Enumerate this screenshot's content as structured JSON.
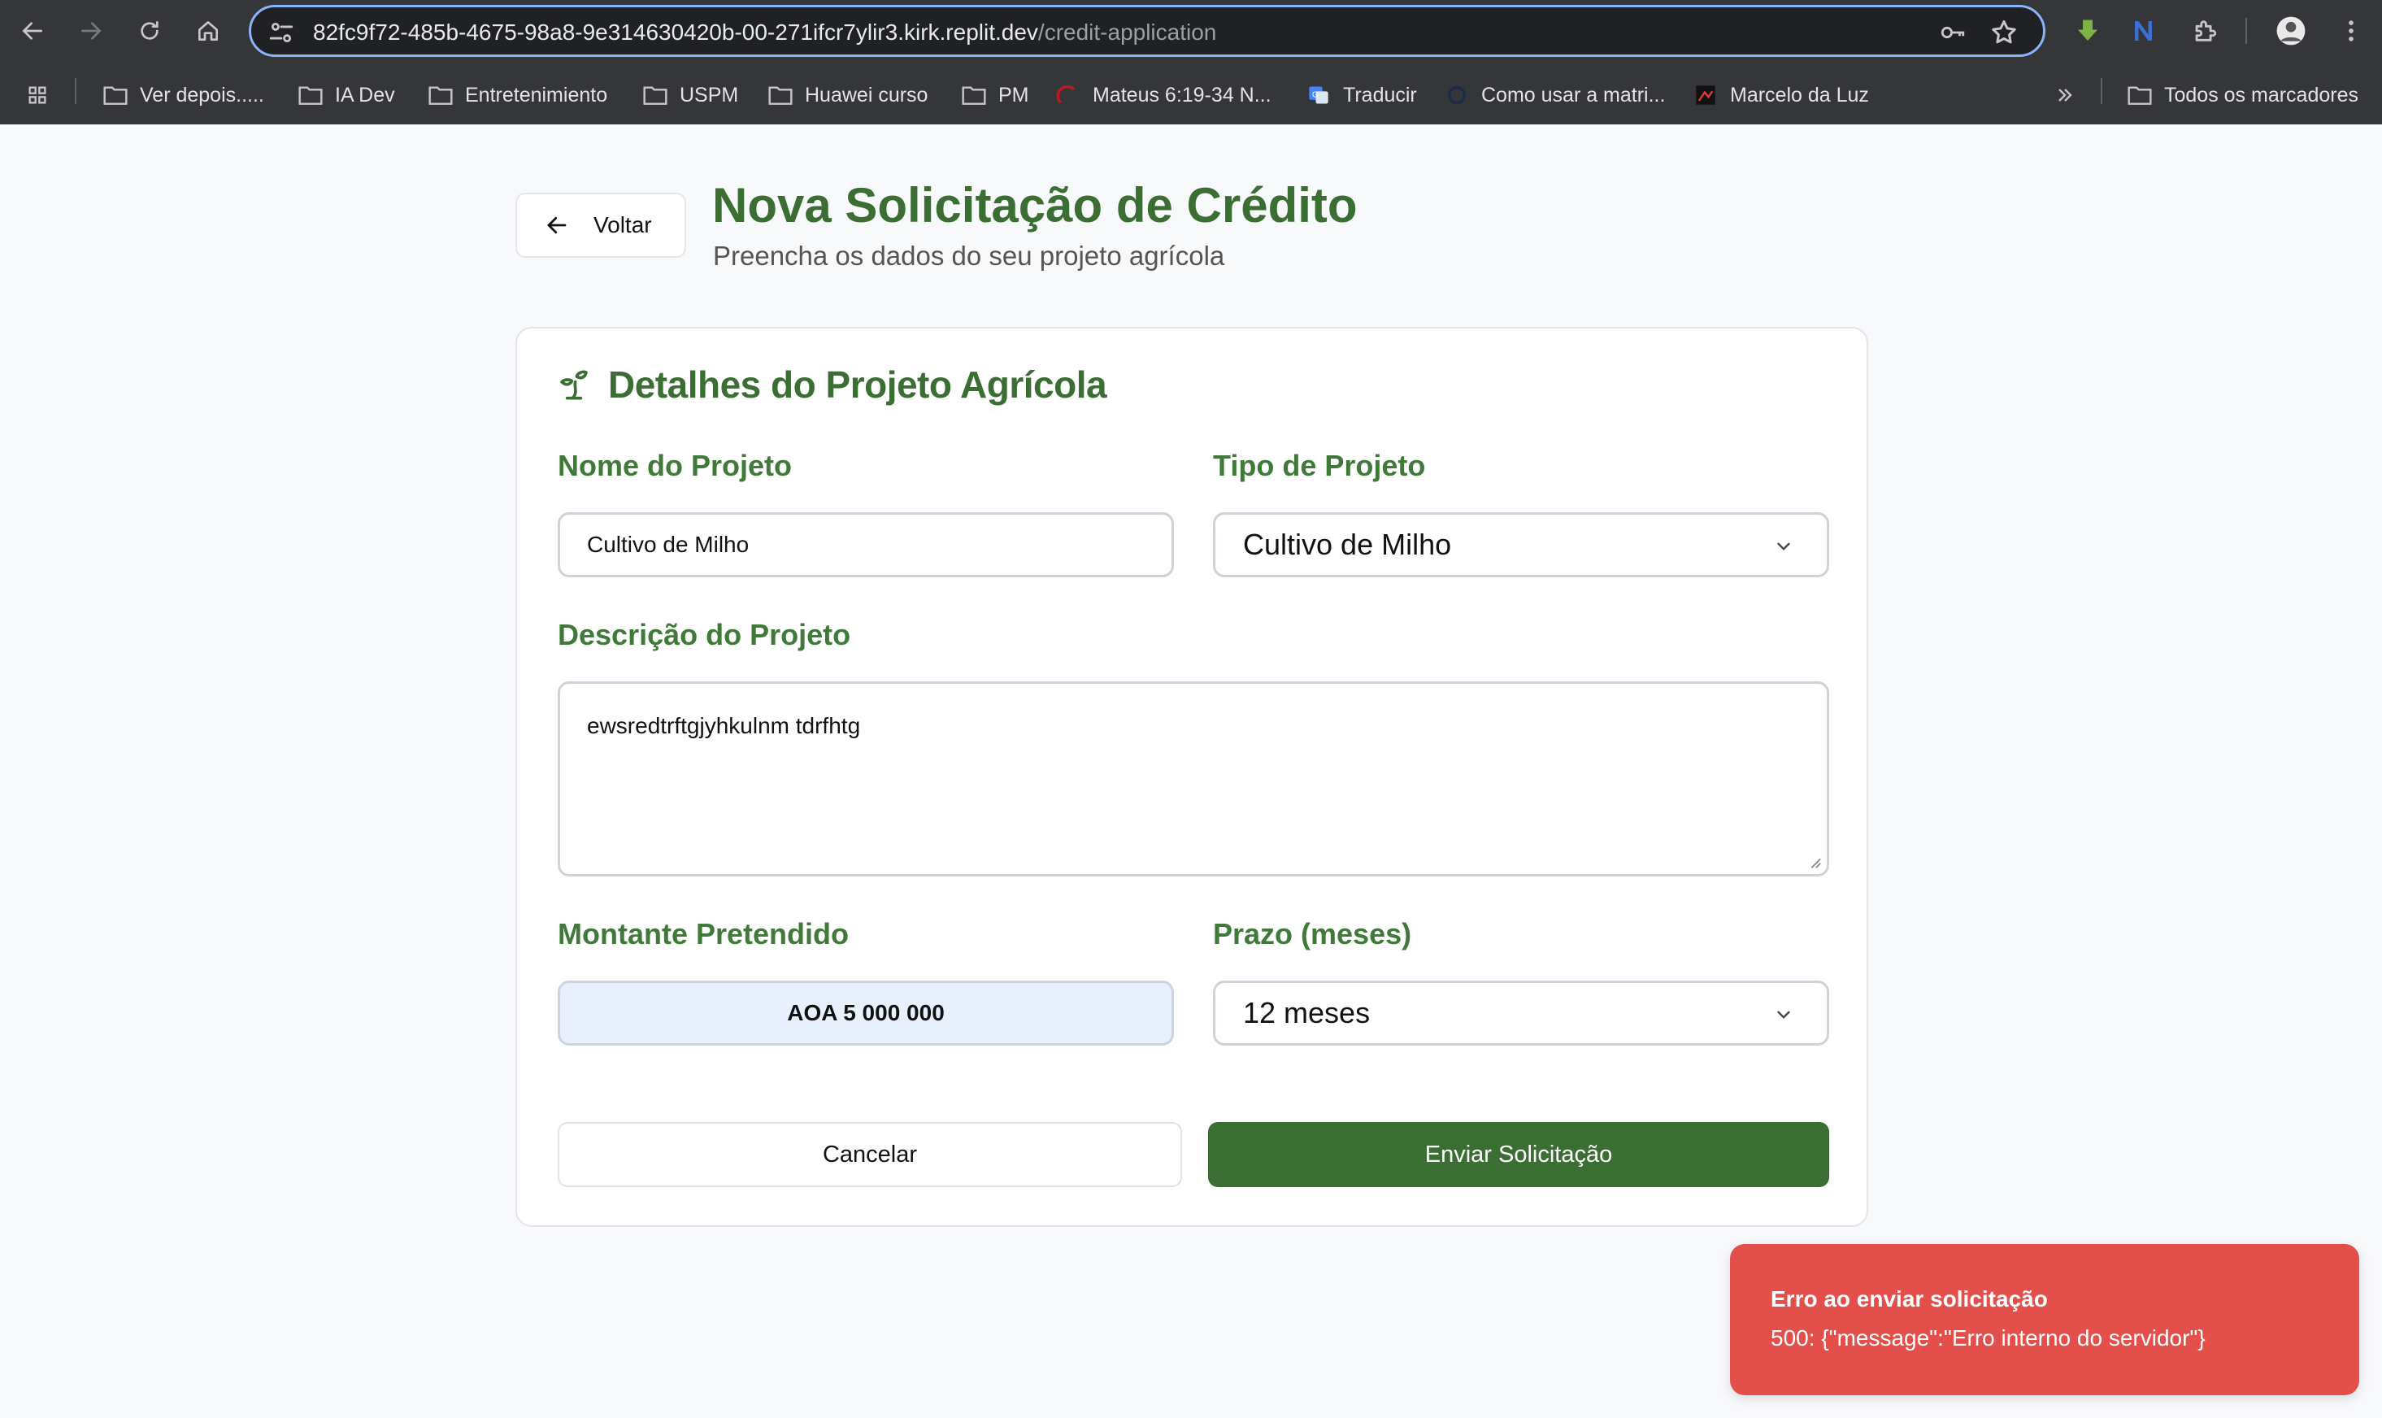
{
  "browser": {
    "url_host": "82fc9f72-485b-4675-98a8-9e314630420b-00-271ifcr7ylir3.kirk.replit.dev",
    "url_path": "/credit-application",
    "bookmarks": [
      {
        "label": "Ver depois.....",
        "icon": "folder-icon"
      },
      {
        "label": "IA Dev",
        "icon": "folder-icon"
      },
      {
        "label": "Entretenimiento",
        "icon": "folder-icon"
      },
      {
        "label": "USPM",
        "icon": "folder-icon"
      },
      {
        "label": "Huawei curso",
        "icon": "folder-icon"
      },
      {
        "label": "PM",
        "icon": "folder-icon"
      },
      {
        "label": "Mateus 6:19-34 N...",
        "icon": "bible-site-icon"
      },
      {
        "label": "Traducir",
        "icon": "translate-icon"
      },
      {
        "label": "Como usar a matri...",
        "icon": "site-icon"
      },
      {
        "label": "Marcelo da Luz",
        "icon": "site-icon"
      }
    ],
    "all_bookmarks": "Todos os marcadores"
  },
  "header": {
    "back_label": "Voltar",
    "title": "Nova Solicitação de Crédito",
    "subtitle": "Preencha os dados do seu projeto agrícola"
  },
  "form": {
    "section_title": "Detalhes do Projeto Agrícola",
    "project_name": {
      "label": "Nome do Projeto",
      "value": "Cultivo de Milho"
    },
    "project_type": {
      "label": "Tipo de Projeto",
      "value": "Cultivo de Milho"
    },
    "description": {
      "label": "Descrição do Projeto",
      "value": "ewsredtrftgjyhkulnm tdrfhtg"
    },
    "amount": {
      "label": "Montante Pretendido",
      "value": "AOA 5 000 000"
    },
    "term": {
      "label": "Prazo (meses)",
      "value": "12 meses"
    },
    "cancel_label": "Cancelar",
    "submit_label": "Enviar Solicitação"
  },
  "toast": {
    "title": "Erro ao enviar solicitação",
    "message": "500: {\"message\":\"Erro interno do servidor\"}"
  },
  "colors": {
    "brand_green": "#3b6e33",
    "error_red": "#e3504b",
    "chrome_bg": "#35363a"
  }
}
